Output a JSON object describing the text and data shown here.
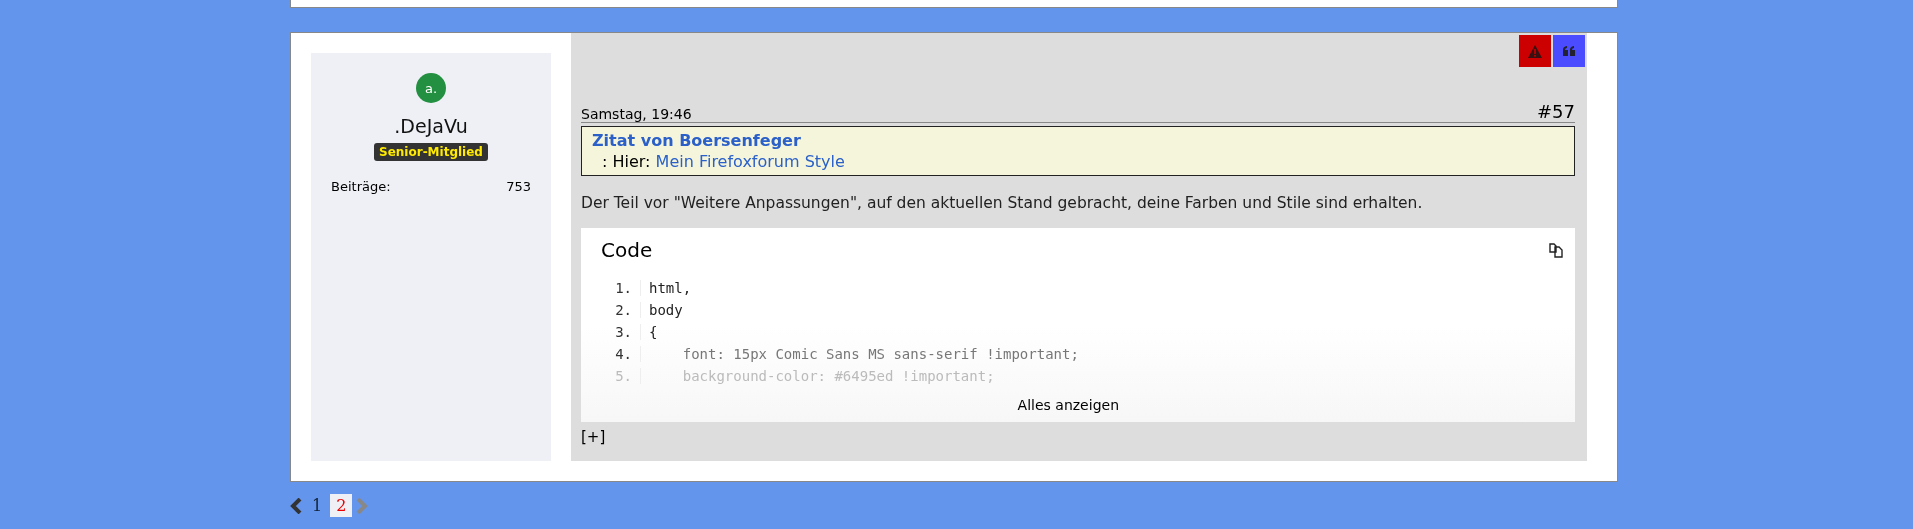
{
  "post": {
    "author": {
      "avatar_letter": "a.",
      "name": ".DeJaVu",
      "rank": "Senior-Mitglied",
      "stats": [
        {
          "label": "Beiträge:",
          "value": "753"
        }
      ]
    },
    "date": "Samstag, 19:46",
    "number": "#57",
    "quote": {
      "title": "Zitat von Boersenfeger",
      "prefix": ": Hier:",
      "link": "Mein Firefoxforum Style"
    },
    "text": "Der Teil vor \"Weitere Anpassungen\", auf den aktuellen Stand gebracht, deine Farben und Stile sind erhalten.",
    "code": {
      "title": "Code",
      "lines": [
        {
          "number": "1.",
          "text": "html,",
          "faded": false
        },
        {
          "number": "2.",
          "text": "body",
          "faded": false
        },
        {
          "number": "3.",
          "text": "{",
          "faded": false
        },
        {
          "number": "4.",
          "text": "    font: 15px Comic Sans MS sans-serif !important;",
          "faded": false
        },
        {
          "number": "5.",
          "text": "    background-color: #6495ed !important;",
          "faded": true
        }
      ],
      "show_all": "Alles anzeigen"
    },
    "expand": "[+]"
  },
  "pagination": {
    "prev": {
      "disabled": false
    },
    "pages": [
      {
        "label": "1",
        "selected": false
      },
      {
        "label": "2",
        "selected": true
      }
    ],
    "next": {
      "disabled": true
    }
  }
}
